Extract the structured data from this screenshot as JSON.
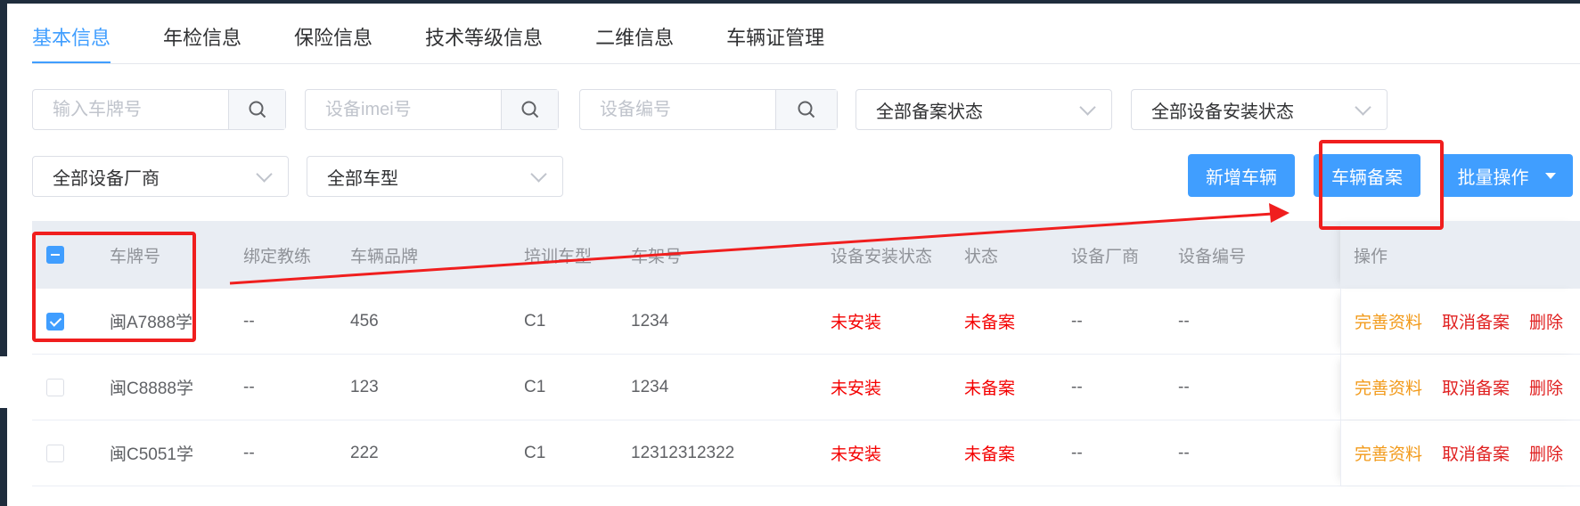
{
  "tabs": [
    {
      "label": "基本信息",
      "active": true
    },
    {
      "label": "年检信息",
      "active": false
    },
    {
      "label": "保险信息",
      "active": false
    },
    {
      "label": "技术等级信息",
      "active": false
    },
    {
      "label": "二维信息",
      "active": false
    },
    {
      "label": "车辆证管理",
      "active": false
    }
  ],
  "filters": {
    "plate_placeholder": "输入车牌号",
    "imei_placeholder": "设备imei号",
    "device_no_placeholder": "设备编号",
    "record_status": "全部备案状态",
    "install_status": "全部设备安装状态",
    "manufacturer": "全部设备厂商",
    "vehicle_type": "全部车型"
  },
  "buttons": {
    "add_vehicle": "新增车辆",
    "vehicle_record": "车辆备案",
    "batch_ops": "批量操作"
  },
  "table": {
    "headers": [
      "车牌号",
      "绑定教练",
      "车辆品牌",
      "培训车型",
      "车架号",
      "设备安装状态",
      "状态",
      "设备厂商",
      "设备编号",
      "操作"
    ],
    "rows": [
      {
        "checked": true,
        "plate": "闽A7888学",
        "coach": "--",
        "brand": "456",
        "train_type": "C1",
        "frame": "1234",
        "install": "未安装",
        "status": "未备案",
        "maker": "--",
        "device_no": "--",
        "act1": "完善资料",
        "act2": "取消备案",
        "act3": "删除"
      },
      {
        "checked": false,
        "plate": "闽C8888学",
        "coach": "--",
        "brand": "123",
        "train_type": "C1",
        "frame": "1234",
        "install": "未安装",
        "status": "未备案",
        "maker": "--",
        "device_no": "--",
        "act1": "完善资料",
        "act2": "取消备案",
        "act3": "删除"
      },
      {
        "checked": false,
        "plate": "闽C5051学",
        "coach": "--",
        "brand": "222",
        "train_type": "C1",
        "frame": "12312312322",
        "install": "未安装",
        "status": "未备案",
        "maker": "--",
        "device_no": "--",
        "act1": "完善资料",
        "act2": "取消备案",
        "act3": "删除"
      }
    ]
  },
  "colors": {
    "primary": "#409eff",
    "danger_text": "#f40000",
    "warning_text": "#f29a1a",
    "annotation": "#f01e1e"
  }
}
